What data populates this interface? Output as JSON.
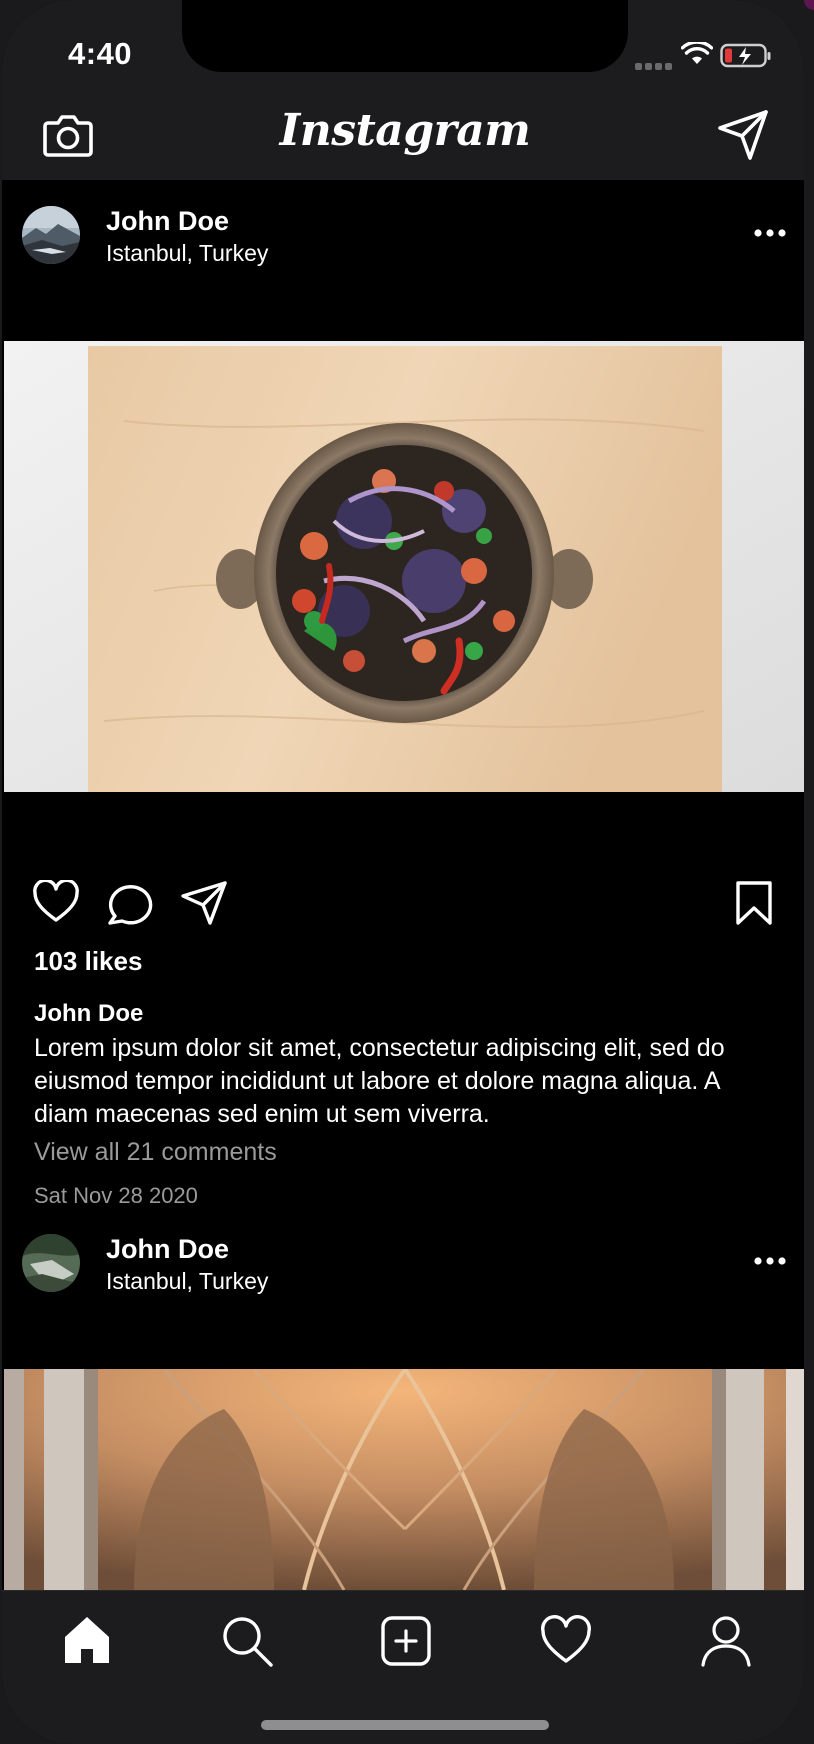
{
  "status_bar": {
    "time": "4:40",
    "icons": [
      "cellular-signal-icon",
      "wifi-icon",
      "battery-charging-icon"
    ]
  },
  "header": {
    "logo_text": "Instagram",
    "left_icon": "camera-icon",
    "right_icon": "direct-message-icon"
  },
  "posts": [
    {
      "username": "John Doe",
      "location": "Istanbul, Turkey",
      "image_description": "salad-bowl-photo",
      "likes": "103 likes",
      "caption_user": "John Doe",
      "caption": "Lorem ipsum dolor sit amet, consectetur adipiscing elit, sed do eiusmod tempor incididunt ut labore et dolore magna aliqua. A diam maecenas sed enim ut sem viverra.",
      "view_comments": "View all 21 comments",
      "date": "Sat Nov 28 2020"
    },
    {
      "username": "John Doe",
      "location": "Istanbul, Turkey",
      "image_description": "cathedral-arches-photo"
    }
  ],
  "actions": [
    "heart-icon",
    "comment-icon",
    "share-icon",
    "bookmark-icon"
  ],
  "tab_bar": {
    "tabs": [
      "home-icon",
      "search-icon",
      "add-post-icon",
      "activity-heart-icon",
      "profile-icon"
    ],
    "active": "home-icon"
  },
  "colors": {
    "background": "#000000",
    "bar_background": "#1c1c1e",
    "text_primary": "#ffffff",
    "text_secondary": "#9a9a9c",
    "battery_low": "#e03a3a"
  }
}
